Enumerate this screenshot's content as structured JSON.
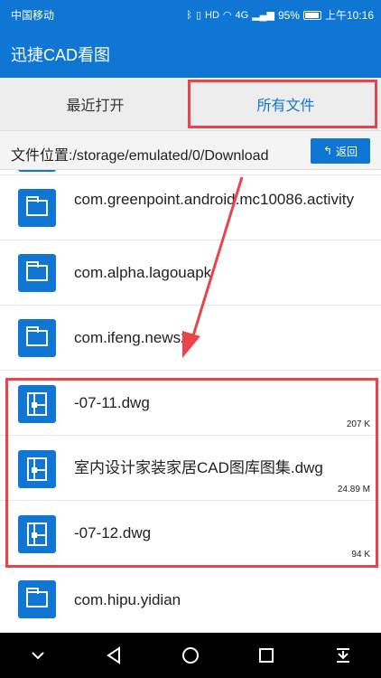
{
  "status_bar": {
    "carrier": "中国移动",
    "battery_percent": "95%",
    "time": "上午10:16",
    "network": "4G",
    "hd": "HD"
  },
  "app": {
    "title": "迅捷CAD看图"
  },
  "tabs": [
    {
      "label": "最近打开",
      "active": false
    },
    {
      "label": "所有文件",
      "active": true
    }
  ],
  "path_bar": {
    "path": "文件位置:/storage/emulated/0/Download",
    "back_label": "返回"
  },
  "files": [
    {
      "type": "folder",
      "name": "com.greenpoint.android.mc10086.activity"
    },
    {
      "type": "folder",
      "name": "com.alpha.lagouapk"
    },
    {
      "type": "folder",
      "name": "com.ifeng.news2"
    },
    {
      "type": "dwg",
      "name": "-07-11.dwg",
      "size": "207 K"
    },
    {
      "type": "dwg",
      "name": "室内设计家装家居CAD图库图集.dwg",
      "size": "24.89 M"
    },
    {
      "type": "dwg",
      "name": "-07-12.dwg",
      "size": "94 K"
    },
    {
      "type": "folder",
      "name": "com.hipu.yidian"
    }
  ],
  "colors": {
    "primary": "#0f76d4",
    "highlight": "#e5454b"
  }
}
